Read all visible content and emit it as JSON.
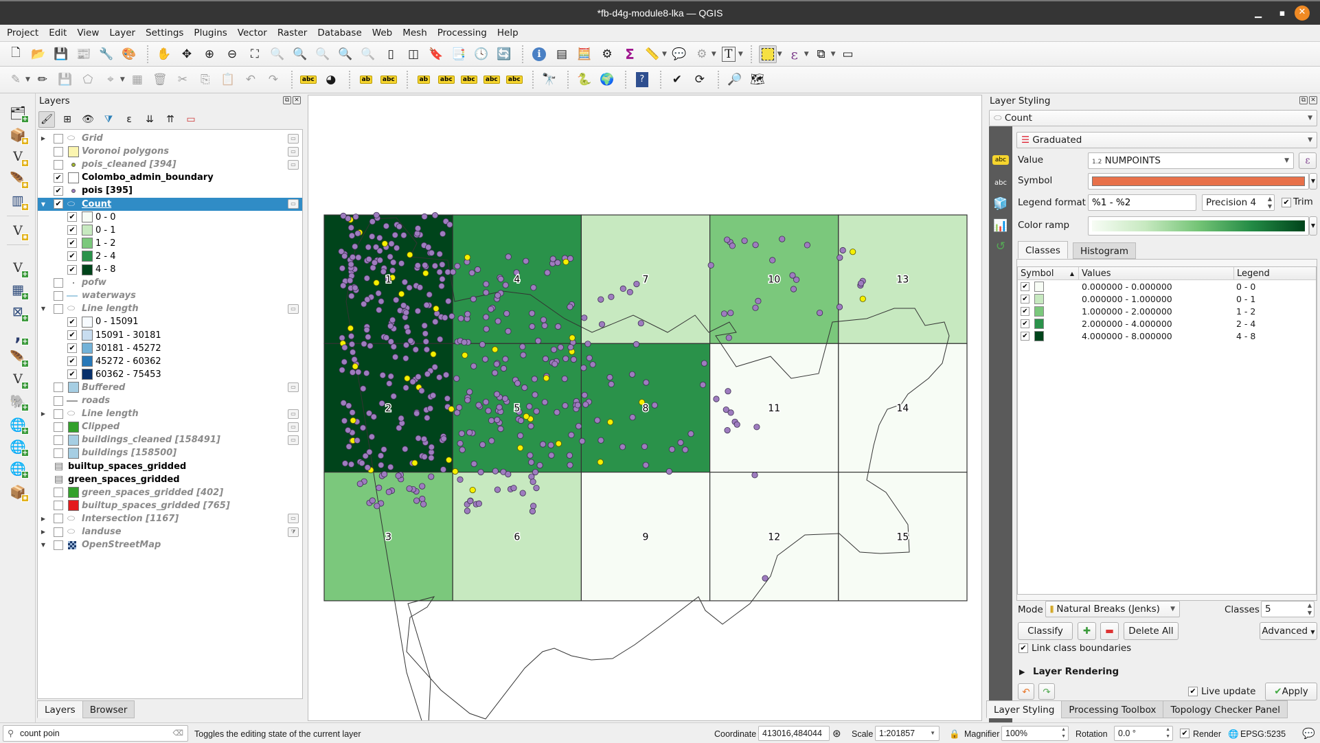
{
  "window": {
    "title": "*fb-d4g-module8-lka — QGIS",
    "minimize": "—",
    "maximize": "▫",
    "close": "✕"
  },
  "menubar": [
    "Project",
    "Edit",
    "View",
    "Layer",
    "Settings",
    "Plugins",
    "Vector",
    "Raster",
    "Database",
    "Web",
    "Mesh",
    "Processing",
    "Help"
  ],
  "toolbar1": [
    {
      "name": "new-project-icon",
      "glyph": "🗋"
    },
    {
      "name": "open-project-icon",
      "glyph": "📂"
    },
    {
      "name": "save-project-icon",
      "glyph": "💾"
    },
    {
      "name": "new-print-layout-icon",
      "glyph": "📰"
    },
    {
      "name": "layout-manager-icon",
      "glyph": "🔧"
    },
    {
      "name": "style-manager-icon",
      "glyph": "🎨"
    },
    {
      "sep": true
    },
    {
      "name": "pan-icon",
      "glyph": "✋"
    },
    {
      "name": "pan-to-selection-icon",
      "glyph": "✥"
    },
    {
      "name": "zoom-in-icon",
      "glyph": "⊕"
    },
    {
      "name": "zoom-out-icon",
      "glyph": "⊖"
    },
    {
      "name": "zoom-full-icon",
      "glyph": "⛶"
    },
    {
      "name": "zoom-to-selection-icon",
      "glyph": "🔍",
      "dim": true
    },
    {
      "name": "zoom-to-layer-icon",
      "glyph": "🔍"
    },
    {
      "name": "zoom-native-icon",
      "glyph": "🔍",
      "dim": true
    },
    {
      "name": "zoom-last-icon",
      "glyph": "🔍"
    },
    {
      "name": "zoom-next-icon",
      "glyph": "🔍",
      "dim": true
    },
    {
      "name": "new-map-view-icon",
      "glyph": "▯"
    },
    {
      "name": "new-3d-map-icon",
      "glyph": "◫"
    },
    {
      "name": "new-bookmark-icon",
      "glyph": "🔖"
    },
    {
      "name": "show-bookmarks-icon",
      "glyph": "📑"
    },
    {
      "name": "temporal-controller-icon",
      "glyph": "🕓"
    },
    {
      "name": "refresh-icon",
      "glyph": "🔄"
    },
    {
      "sep": true
    },
    {
      "name": "identify-icon",
      "glyph": "ℹ"
    },
    {
      "name": "attribute-table-icon",
      "glyph": "▤"
    },
    {
      "name": "field-calculator-icon",
      "glyph": "🧮"
    },
    {
      "name": "processing-toolbox-icon",
      "glyph": "⚙"
    },
    {
      "name": "statistical-summary-icon",
      "glyph": "Σ"
    },
    {
      "name": "measure-icon",
      "glyph": "📏",
      "dd": true
    },
    {
      "name": "map-tips-icon",
      "glyph": "💬"
    },
    {
      "name": "run-action-icon",
      "glyph": "⚙",
      "dim": true,
      "dd": true
    },
    {
      "name": "text-annotation-icon",
      "glyph": "T",
      "dd": true
    },
    {
      "sep": true
    },
    {
      "name": "select-features-icon",
      "glyph": "⬚",
      "active": true,
      "dd": true
    },
    {
      "name": "select-by-expression-icon",
      "glyph": "ε",
      "dd": true
    },
    {
      "name": "deselect-all-icon",
      "glyph": "⧉",
      "dd": true
    },
    {
      "name": "select-by-location-icon",
      "glyph": "▭"
    }
  ],
  "toolbar2": [
    {
      "name": "current-edits-icon",
      "glyph": "✎",
      "dim": true,
      "dd": true
    },
    {
      "name": "toggle-editing-icon",
      "glyph": "✏"
    },
    {
      "name": "save-layer-edits-icon",
      "glyph": "💾",
      "dim": true
    },
    {
      "name": "digitize-polygon-icon",
      "glyph": "⬠",
      "dim": true
    },
    {
      "name": "vertex-tool-icon",
      "glyph": "⌖",
      "dim": true,
      "dd": true
    },
    {
      "name": "modify-attributes-icon",
      "glyph": "▦",
      "dim": true
    },
    {
      "name": "delete-selected-icon",
      "glyph": "🗑",
      "dim": true
    },
    {
      "name": "cut-features-icon",
      "glyph": "✂",
      "dim": true
    },
    {
      "name": "copy-features-icon",
      "glyph": "⎘",
      "dim": true
    },
    {
      "name": "paste-features-icon",
      "glyph": "📋",
      "dim": true
    },
    {
      "name": "undo-icon",
      "glyph": "↶",
      "dim": true
    },
    {
      "name": "redo-icon",
      "glyph": "↷",
      "dim": true
    },
    {
      "sep": true
    },
    {
      "name": "layer-labeling-icon",
      "glyph": "abc"
    },
    {
      "name": "layer-diagram-icon",
      "glyph": "◕"
    },
    {
      "sep": true
    },
    {
      "name": "pin-labels-icon",
      "glyph": "ab"
    },
    {
      "name": "highlight-pinned-labels-icon",
      "glyph": "abc"
    },
    {
      "sep": true
    },
    {
      "name": "move-label-icon",
      "glyph": "ab"
    },
    {
      "name": "show-hide-labels-icon",
      "glyph": "abc"
    },
    {
      "name": "move-label-arrow-icon",
      "glyph": "abc"
    },
    {
      "name": "rotate-label-icon",
      "glyph": "abc"
    },
    {
      "name": "change-label-icon",
      "glyph": "abc"
    },
    {
      "sep": true
    },
    {
      "name": "quickosm-icon",
      "glyph": "🔭"
    },
    {
      "sep": true
    },
    {
      "name": "python-console-icon",
      "glyph": "🐍"
    },
    {
      "name": "globe-icon",
      "glyph": "🌍"
    },
    {
      "sep": true
    },
    {
      "name": "help-icon",
      "glyph": "?"
    },
    {
      "sep": true
    },
    {
      "name": "topology-checker-icon",
      "glyph": "✔"
    },
    {
      "name": "table-refresh-icon",
      "glyph": "⟳"
    },
    {
      "sep": true
    },
    {
      "name": "search-plugin-icon",
      "glyph": "🔎"
    },
    {
      "name": "georeferencer-icon",
      "glyph": "🗺"
    }
  ],
  "vtoolbar": [
    {
      "name": "data-source-manager-icon",
      "glyph": "🗂",
      "badge": "plus"
    },
    {
      "name": "new-geopackage-layer-icon",
      "glyph": "📦",
      "badge": "star"
    },
    {
      "name": "new-shapefile-layer-icon",
      "glyph": "V",
      "badge": "star"
    },
    {
      "name": "new-spatialite-layer-icon",
      "glyph": "🪶",
      "badge": "star"
    },
    {
      "name": "new-temporary-layer-icon",
      "glyph": "▥",
      "badge": "star"
    },
    {
      "name": "new-virtual-layer-icon",
      "glyph": "V",
      "badge": "star"
    },
    {
      "name": "add-vector-layer-icon",
      "glyph": "V",
      "badge": "plus"
    },
    {
      "name": "add-raster-layer-icon",
      "glyph": "▦",
      "badge": "plus"
    },
    {
      "name": "add-mesh-layer-icon",
      "glyph": "⊠",
      "badge": "plus"
    },
    {
      "name": "add-delimited-text-icon",
      "glyph": ",",
      "badge": "plus"
    },
    {
      "name": "add-spatialite-layer-icon",
      "glyph": "🪶",
      "badge": "plus"
    },
    {
      "name": "add-virtual-layer-icon",
      "glyph": "V",
      "badge": "plus"
    },
    {
      "name": "add-postgis-layer-icon",
      "glyph": "🐘",
      "badge": "plus"
    },
    {
      "name": "add-wms-layer-icon",
      "glyph": "🌐",
      "badge": "plus"
    },
    {
      "name": "add-wfs-layer-icon",
      "glyph": "🌐",
      "badge": "plus"
    },
    {
      "name": "add-wcs-layer-icon",
      "glyph": "🌐",
      "badge": "plus"
    },
    {
      "name": "new-geopackage-dropdown-icon",
      "glyph": "📦",
      "badge": "star"
    }
  ],
  "layers_panel": {
    "title": "Layers",
    "tools": [
      "style-layer-icon",
      "add-group-icon",
      "manage-visibility-icon",
      "filter-legend-icon",
      "filter-by-expression-icon",
      "expand-all-icon",
      "collapse-all-icon",
      "remove-layer-icon"
    ],
    "items": [
      {
        "label": "Grid",
        "checked": false,
        "state": "off",
        "expander": "right",
        "symbol": "polygon-outline",
        "indicator": true
      },
      {
        "label": "Voronoi polygons",
        "checked": false,
        "state": "off",
        "symbol": "fill",
        "color": "#fbf5b0",
        "indicator": true
      },
      {
        "label": "pois_cleaned [394]",
        "checked": false,
        "state": "off",
        "symbol": "point",
        "color": "#a4b82e",
        "indicator": true
      },
      {
        "label": "Colombo_admin_boundary",
        "checked": true,
        "state": "on",
        "symbol": "fill",
        "color": "#ffffff"
      },
      {
        "label": "pois [395]",
        "checked": true,
        "state": "on",
        "symbol": "point",
        "color": "#9e7cbf"
      },
      {
        "label": "Count",
        "checked": true,
        "state": "selected",
        "expander": "down",
        "symbol": "polygon-outline",
        "indicator": true
      },
      {
        "label": "0 - 0",
        "checked": true,
        "state": "legend",
        "symbol": "fill",
        "color": "#f7fcf5",
        "indent": true
      },
      {
        "label": "0 - 1",
        "checked": true,
        "state": "legend",
        "symbol": "fill",
        "color": "#c7e9c0",
        "indent": true
      },
      {
        "label": "1 - 2",
        "checked": true,
        "state": "legend",
        "symbol": "fill",
        "color": "#7bc87c",
        "indent": true
      },
      {
        "label": "2 - 4",
        "checked": true,
        "state": "legend",
        "symbol": "fill",
        "color": "#2a924a",
        "indent": true
      },
      {
        "label": "4 - 8",
        "checked": true,
        "state": "legend",
        "symbol": "fill",
        "color": "#00441b",
        "indent": true
      },
      {
        "label": "pofw",
        "checked": false,
        "state": "off",
        "symbol": "dot-small",
        "color": "#888888"
      },
      {
        "label": "waterways",
        "checked": false,
        "state": "off",
        "symbol": "line",
        "color": "#a6cee3"
      },
      {
        "label": "Line length",
        "checked": false,
        "state": "off",
        "expander": "down",
        "symbol": "polygon-outline",
        "indicator": true
      },
      {
        "label": "0 - 15091",
        "checked": true,
        "state": "legend",
        "symbol": "fill",
        "color": "#f7fbff",
        "indent": true
      },
      {
        "label": "15091 - 30181",
        "checked": true,
        "state": "legend",
        "symbol": "fill",
        "color": "#c8ddf0",
        "indent": true
      },
      {
        "label": "30181 - 45272",
        "checked": true,
        "state": "legend",
        "symbol": "fill",
        "color": "#73b2d8",
        "indent": true
      },
      {
        "label": "45272 - 60362",
        "checked": true,
        "state": "legend",
        "symbol": "fill",
        "color": "#2878b8",
        "indent": true
      },
      {
        "label": "60362 - 75453",
        "checked": true,
        "state": "legend",
        "symbol": "fill",
        "color": "#08306b",
        "indent": true
      },
      {
        "label": "Buffered",
        "checked": false,
        "state": "off",
        "symbol": "fill",
        "color": "#a6cee3",
        "indicator": true
      },
      {
        "label": "roads",
        "checked": false,
        "state": "off",
        "symbol": "line",
        "color": "#999999"
      },
      {
        "label": "Line length",
        "checked": false,
        "state": "off",
        "expander": "right",
        "symbol": "polygon-outline",
        "indicator": true
      },
      {
        "label": "Clipped",
        "checked": false,
        "state": "off",
        "symbol": "fill",
        "color": "#33a02c",
        "indicator": true
      },
      {
        "label": "buildings_cleaned [158491]",
        "checked": false,
        "state": "off",
        "symbol": "fill",
        "color": "#a6cee3",
        "indicator": true
      },
      {
        "label": "buildings [158500]",
        "checked": false,
        "state": "off",
        "symbol": "fill",
        "color": "#a6cee3"
      },
      {
        "label": "builtup_spaces_gridded",
        "checked": null,
        "state": "on",
        "symbol": "table"
      },
      {
        "label": "green_spaces_gridded",
        "checked": null,
        "state": "on",
        "symbol": "table"
      },
      {
        "label": "green_spaces_gridded [402]",
        "checked": false,
        "state": "off",
        "symbol": "fill",
        "color": "#33a02c"
      },
      {
        "label": "builtup_spaces_gridded [765]",
        "checked": false,
        "state": "off",
        "symbol": "fill",
        "color": "#e31a1c"
      },
      {
        "label": "Intersection [1167]",
        "checked": false,
        "state": "off",
        "expander": "right",
        "symbol": "polygon-outline",
        "indicator": true
      },
      {
        "label": "landuse",
        "checked": false,
        "state": "off",
        "expander": "right",
        "symbol": "polygon-outline",
        "indicator": "filter"
      },
      {
        "label": "OpenStreetMap",
        "checked": false,
        "state": "off",
        "expander": "down",
        "symbol": "raster"
      }
    ],
    "tabs": [
      "Layers",
      "Browser"
    ],
    "active_tab": "Layers"
  },
  "map": {
    "grid_cells": [
      {
        "id": "1",
        "col": 0,
        "row": 0,
        "class": 4
      },
      {
        "id": "2",
        "col": 0,
        "row": 1,
        "class": 4
      },
      {
        "id": "3",
        "col": 0,
        "row": 2,
        "class": 2
      },
      {
        "id": "4",
        "col": 1,
        "row": 0,
        "class": 3
      },
      {
        "id": "5",
        "col": 1,
        "row": 1,
        "class": 3
      },
      {
        "id": "6",
        "col": 1,
        "row": 2,
        "class": 1
      },
      {
        "id": "7",
        "col": 2,
        "row": 0,
        "class": 1
      },
      {
        "id": "8",
        "col": 2,
        "row": 1,
        "class": 3
      },
      {
        "id": "9",
        "col": 2,
        "row": 2,
        "class": 0
      },
      {
        "id": "10",
        "col": 3,
        "row": 0,
        "class": 2
      },
      {
        "id": "11",
        "col": 3,
        "row": 1,
        "class": 0
      },
      {
        "id": "12",
        "col": 3,
        "row": 2,
        "class": 0
      },
      {
        "id": "13",
        "col": 4,
        "row": 0,
        "class": 1
      },
      {
        "id": "14",
        "col": 4,
        "row": 1,
        "class": 0
      },
      {
        "id": "15",
        "col": 4,
        "row": 2,
        "class": 0
      }
    ],
    "class_colors": [
      "#f7fcf5",
      "#c7e9c0",
      "#7bc87c",
      "#2a924a",
      "#00441b"
    ],
    "poi_color": "#9e7cbf",
    "poi_highlight_color": "#f5f000"
  },
  "style_panel": {
    "title": "Layer Styling",
    "layer": "Count",
    "renderer": "Graduated",
    "value_label": "Value",
    "value_type": "1.2",
    "value": "NUMPOINTS",
    "symbol_label": "Symbol",
    "symbol_color": "#e8714a",
    "legend_format_label": "Legend format",
    "legend_format": "%1 - %2",
    "precision": "Precision 4",
    "trim_label": "Trim",
    "trim_checked": true,
    "color_ramp_label": "Color ramp",
    "color_ramp": [
      "#f7fcf5",
      "#c7e9c0",
      "#74c476",
      "#238b45",
      "#00441b"
    ],
    "tabs": [
      "Classes",
      "Histogram"
    ],
    "active_tab": "Classes",
    "table_headers": [
      "Symbol",
      "Values",
      "Legend"
    ],
    "classes": [
      {
        "checked": true,
        "color": "#f7fcf5",
        "values": "0.000000 - 0.000000",
        "legend": "0 - 0"
      },
      {
        "checked": true,
        "color": "#c7e9c0",
        "values": "0.000000 - 1.000000",
        "legend": "0 - 1"
      },
      {
        "checked": true,
        "color": "#7bc87c",
        "values": "1.000000 - 2.000000",
        "legend": "1 - 2"
      },
      {
        "checked": true,
        "color": "#2a924a",
        "values": "2.000000 - 4.000000",
        "legend": "2 - 4"
      },
      {
        "checked": true,
        "color": "#00441b",
        "values": "4.000000 - 8.000000",
        "legend": "4 - 8"
      }
    ],
    "mode_label": "Mode",
    "mode": "Natural Breaks (Jenks)",
    "classes_label": "Classes",
    "classes_count": "5",
    "classify": "Classify",
    "delete_all": "Delete All",
    "advanced": "Advanced",
    "link_boundaries": "Link class boundaries",
    "layer_rendering": "Layer Rendering",
    "live_update": "Live update",
    "apply": "Apply",
    "bottom_tabs": [
      "Layer Styling",
      "Processing Toolbox",
      "Topology Checker Panel"
    ],
    "side_tabs": [
      "symbology-icon",
      "labels-icon",
      "mask-icon",
      "3d-view-icon",
      "diagrams-icon",
      "history-icon"
    ]
  },
  "statusbar": {
    "search_value": "count poin",
    "message": "Toggles the editing state of the current layer",
    "coordinate_label": "Coordinate",
    "coordinate": "413016,484044",
    "scale_label": "Scale",
    "scale": "1:201857",
    "magnifier_label": "Magnifier",
    "magnifier": "100%",
    "rotation_label": "Rotation",
    "rotation": "0.0 °",
    "render_label": "Render",
    "render_checked": true,
    "crs": "EPSG:5235"
  }
}
